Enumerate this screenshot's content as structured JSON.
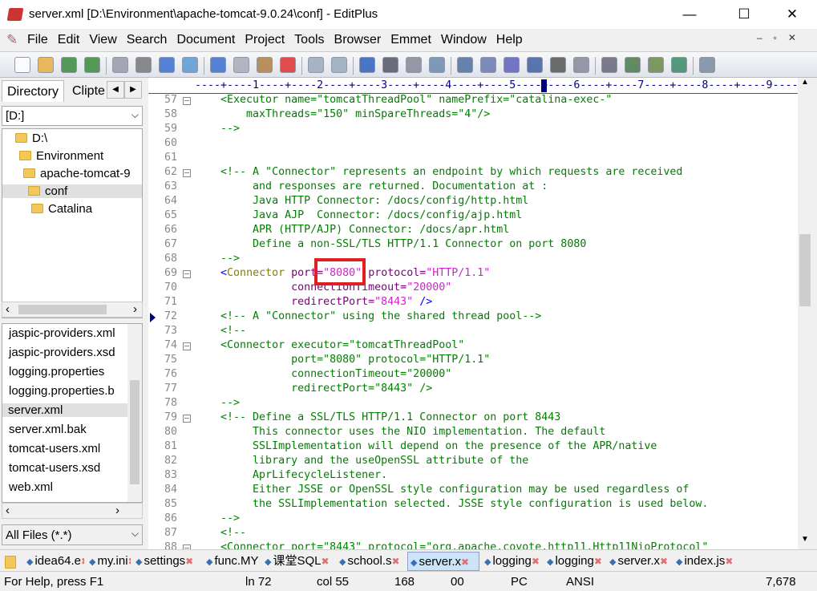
{
  "window": {
    "title": "server.xml [D:\\Environment\\apache-tomcat-9.0.24\\conf] - EditPlus",
    "minimize": "—",
    "maximize": "☐",
    "close": "✕"
  },
  "menu": [
    "File",
    "Edit",
    "View",
    "Search",
    "Document",
    "Project",
    "Tools",
    "Browser",
    "Emmet",
    "Window",
    "Help"
  ],
  "toolbar": [
    "new-file",
    "open",
    "save",
    "save-all",
    "print-preview",
    "print",
    "spell-check",
    "html-preview",
    "cut",
    "copy",
    "paste",
    "delete",
    "undo",
    "redo",
    "find",
    "replace",
    "find-in-files",
    "go-to",
    "font",
    "hx",
    "word-wrap",
    "indent",
    "column",
    "settings",
    "toggle-panel",
    "directory-panel",
    "cliptext",
    "output",
    "help"
  ],
  "left_panel": {
    "tabs": [
      "Directory",
      "Clipte"
    ],
    "drive": "[D:]",
    "tree": [
      {
        "label": "D:\\",
        "level": 0
      },
      {
        "label": "Environment",
        "level": 1
      },
      {
        "label": "apache-tomcat-9",
        "level": 2
      },
      {
        "label": "conf",
        "level": 3,
        "selected": true
      },
      {
        "label": "Catalina",
        "level": 4
      }
    ],
    "files": [
      "jaspic-providers.xml",
      "jaspic-providers.xsd",
      "logging.properties",
      "logging.properties.b",
      "server.xml",
      "server.xml.bak",
      "tomcat-users.xml",
      "tomcat-users.xsd",
      "web.xml"
    ],
    "selected_file": "server.xml",
    "filter": "All Files (*.*)"
  },
  "ruler": "----+----1----+----2----+----3----+----4----+----5----+----6----+----7----+----8----+----9----",
  "code_lines": [
    {
      "n": "57",
      "fold": true,
      "tokens": [
        [
          "c",
          "    <Executor name=\"tomcatThreadPool\" namePrefix=\"catalina-exec-\""
        ]
      ]
    },
    {
      "n": "58",
      "tokens": [
        [
          "c",
          "        maxThreads=\"150\" minSpareThreads=\"4\"/>"
        ]
      ]
    },
    {
      "n": "59",
      "tokens": [
        [
          "c",
          "    -->"
        ]
      ]
    },
    {
      "n": "60",
      "tokens": []
    },
    {
      "n": "61",
      "tokens": []
    },
    {
      "n": "62",
      "fold": true,
      "tokens": [
        [
          "c",
          "    <!-- A \"Connector\" represents an endpoint by which requests are received"
        ]
      ]
    },
    {
      "n": "63",
      "tokens": [
        [
          "c",
          "         and responses are returned. Documentation at :"
        ]
      ]
    },
    {
      "n": "64",
      "tokens": [
        [
          "c",
          "         Java HTTP Connector: /docs/config/http.html"
        ]
      ]
    },
    {
      "n": "65",
      "tokens": [
        [
          "c",
          "         Java AJP  Connector: /docs/config/ajp.html"
        ]
      ]
    },
    {
      "n": "66",
      "tokens": [
        [
          "c",
          "         APR (HTTP/AJP) Connector: /docs/apr.html"
        ]
      ]
    },
    {
      "n": "67",
      "tokens": [
        [
          "c",
          "         Define a non-SSL/TLS HTTP/1.1 Connector on port 8080"
        ]
      ]
    },
    {
      "n": "68",
      "tokens": [
        [
          "c",
          "    -->"
        ]
      ]
    },
    {
      "n": "69",
      "fold": true,
      "tokens": [
        [
          "p",
          "    "
        ],
        [
          "t",
          "<"
        ],
        [
          "n",
          "Connector "
        ],
        [
          "a",
          "port="
        ],
        [
          "v",
          "\"8080\""
        ],
        [
          "a",
          " protocol="
        ],
        [
          "v",
          "\"HTTP/1.1\""
        ]
      ]
    },
    {
      "n": "70",
      "tokens": [
        [
          "a",
          "               connectionTimeout="
        ],
        [
          "v",
          "\"20000\""
        ]
      ]
    },
    {
      "n": "71",
      "tokens": [
        [
          "a",
          "               redirectPort="
        ],
        [
          "v",
          "\"8443\""
        ],
        [
          "t",
          " />"
        ]
      ]
    },
    {
      "n": "72",
      "marker": true,
      "tokens": [
        [
          "c",
          "    <!-- A \"Connector\" using the shared thread pool-->"
        ]
      ]
    },
    {
      "n": "73",
      "tokens": [
        [
          "c",
          "    <!--"
        ]
      ]
    },
    {
      "n": "74",
      "fold": true,
      "tokens": [
        [
          "c",
          "    <Connector executor=\"tomcatThreadPool\""
        ]
      ]
    },
    {
      "n": "75",
      "tokens": [
        [
          "c",
          "               port=\"8080\" protocol=\"HTTP/1.1\""
        ]
      ]
    },
    {
      "n": "76",
      "tokens": [
        [
          "c",
          "               connectionTimeout=\"20000\""
        ]
      ]
    },
    {
      "n": "77",
      "tokens": [
        [
          "c",
          "               redirectPort=\"8443\" />"
        ]
      ]
    },
    {
      "n": "78",
      "tokens": [
        [
          "c",
          "    -->"
        ]
      ]
    },
    {
      "n": "79",
      "fold": true,
      "tokens": [
        [
          "c",
          "    <!-- Define a SSL/TLS HTTP/1.1 Connector on port 8443"
        ]
      ]
    },
    {
      "n": "80",
      "tokens": [
        [
          "c",
          "         This connector uses the NIO implementation. The default"
        ]
      ]
    },
    {
      "n": "81",
      "tokens": [
        [
          "c",
          "         SSLImplementation will depend on the presence of the APR/native"
        ]
      ]
    },
    {
      "n": "82",
      "tokens": [
        [
          "c",
          "         library and the useOpenSSL attribute of the"
        ]
      ]
    },
    {
      "n": "83",
      "tokens": [
        [
          "c",
          "         AprLifecycleListener."
        ]
      ]
    },
    {
      "n": "84",
      "tokens": [
        [
          "c",
          "         Either JSSE or OpenSSL style configuration may be used regardless of"
        ]
      ]
    },
    {
      "n": "85",
      "tokens": [
        [
          "c",
          "         the SSLImplementation selected. JSSE style configuration is used below."
        ]
      ]
    },
    {
      "n": "86",
      "tokens": [
        [
          "c",
          "    -->"
        ]
      ]
    },
    {
      "n": "87",
      "tokens": [
        [
          "c",
          "    <!--"
        ]
      ]
    },
    {
      "n": "88",
      "fold": true,
      "tokens": [
        [
          "c",
          "    <Connector port=\"8443\" protocol=\"org.apache.coyote.http11.Http11NioProtocol\""
        ]
      ]
    }
  ],
  "doc_tabs": [
    "idea64.e",
    "my.ini",
    "settings",
    "func.MY",
    "课堂SQL",
    "school.s",
    "server.x",
    "logging",
    "logging",
    "server.x",
    "index.js"
  ],
  "active_tab": "server.x",
  "status": {
    "help": "For Help, press F1",
    "line": "ln 72",
    "col": "col 55",
    "count": "168",
    "code": "00",
    "mode": "PC",
    "encoding": "ANSI",
    "size": "7,678"
  },
  "colors": {
    "highlight_box": "#e02020",
    "selection": "#cce4f7",
    "comment": "#008000",
    "value": "#d020d0"
  }
}
